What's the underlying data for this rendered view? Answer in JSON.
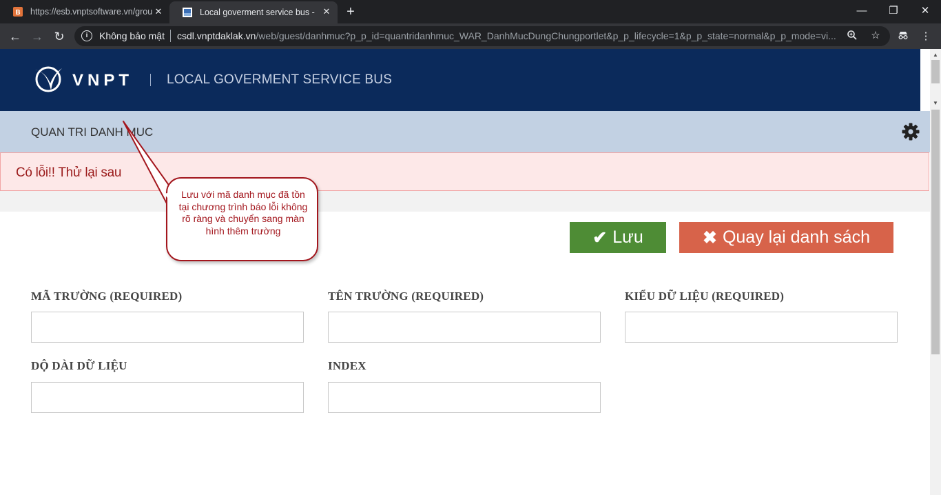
{
  "browser": {
    "tabs": [
      {
        "title": "https://esb.vnptsoftware.vn/grou"
      },
      {
        "title": "Local goverment service bus - Life"
      }
    ],
    "omnibox": {
      "security_label": "Không bảo mật",
      "url_host": "csdl.vnptdaklak.vn",
      "url_path": "/web/guest/danhmuc?p_p_id=quantridanhmuc_WAR_DanhMucDungChungportlet&p_p_lifecycle=1&p_p_state=normal&p_p_mode=vi..."
    }
  },
  "header": {
    "brand": "VNPT",
    "subtitle": "LOCAL GOVERMENT SERVICE BUS"
  },
  "portlet": {
    "title": "QUAN TRI DANH MUC"
  },
  "alert": {
    "message": "Có lỗi!! Thử lại sau"
  },
  "annotation": {
    "text": "Lưu với mã danh mục đã tồn tại chương trình báo lỗi không rõ ràng và chuyển sang màn hình thêm trường"
  },
  "actions": {
    "save_label": "Lưu",
    "back_label": "Quay lại danh sách"
  },
  "form": {
    "fields": [
      {
        "label": "MÃ TRƯỜNG (REQUIRED)",
        "value": ""
      },
      {
        "label": "TÊN TRƯỜNG (REQUIRED)",
        "value": ""
      },
      {
        "label": "KIỂU DỮ LIỆU (REQUIRED)",
        "value": ""
      },
      {
        "label": "DỘ DÀI DỮ LIỆU",
        "value": ""
      },
      {
        "label": "INDEX",
        "value": ""
      }
    ]
  },
  "colors": {
    "header_bg": "#0b2a5b",
    "titlebar_bg": "#c2d1e3",
    "alert_bg": "#fde8e8",
    "save_button": "#4e8c35",
    "back_button": "#d7634a",
    "annotation": "#a3161d"
  }
}
